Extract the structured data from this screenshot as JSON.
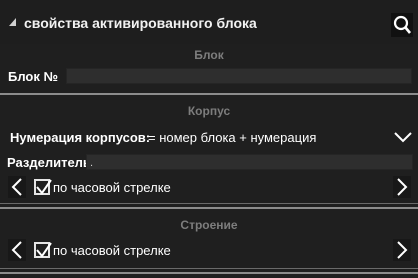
{
  "header": {
    "title": "свойства активированного блока",
    "collapse_icon": "triangle-collapse-icon",
    "search_icon": "search-icon"
  },
  "block_section": {
    "title": "Блок",
    "block_no_label": "Блок №",
    "block_no_value": ""
  },
  "body_section": {
    "title": "Корпус",
    "numbering_label": "Нумерация корпусов:",
    "numbering_value": "= номер блока + нумерация",
    "separator_label": "Разделитель",
    "separator_value": ".",
    "direction_label": "по часовой стрелке",
    "direction_checked": true
  },
  "building_section": {
    "title": "Строение",
    "direction_label": "по часовой стрелке",
    "direction_checked": true
  },
  "colors": {
    "background": "#1f1f1f",
    "section_title": "#7d7d7d",
    "separator": "#8c8c8c"
  }
}
